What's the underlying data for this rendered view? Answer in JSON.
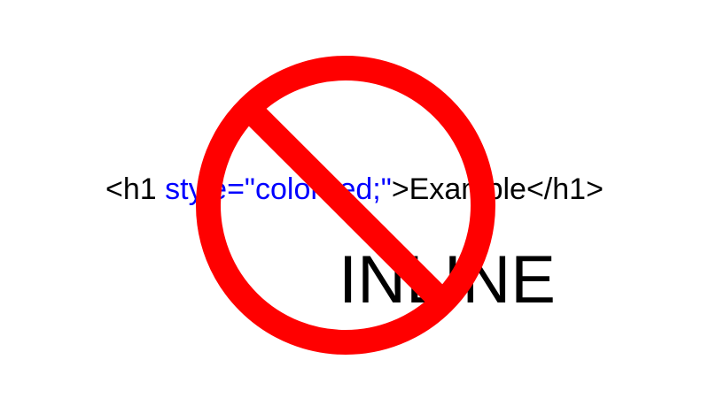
{
  "code_snippet": {
    "open_tag_start": "<h1 ",
    "attribute": "style=\"color:red;\"",
    "tag_close_and_content": ">Example</h1>"
  },
  "label": "INLINE",
  "colors": {
    "background": "#ffffff",
    "text": "#000000",
    "attribute_text": "#0000ff",
    "prohibition_sign": "#ff0000"
  },
  "icon": "prohibition-sign-icon"
}
